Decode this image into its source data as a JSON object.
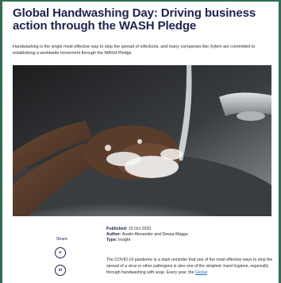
{
  "article": {
    "title": "Global Handwashing Day: Driving business action through the WASH Pledge",
    "intro": "Handwashing is the single most effective way to stop the spread of infections, and many companies like Xylem are committed to establishing a worldwide movement through the WASH Pledge",
    "meta": {
      "published_label": "Published:",
      "published_value": "15 Oct 2020",
      "author_label": "Author:",
      "author_value": "Austin Alexander and Deepa Maggo",
      "type_label": "Type:",
      "type_value": "Insight"
    },
    "body_text": "The COVID-19 pandemic is a stark reminder that one of the most effective ways to stop the spread of a virus or other pathogens is also one of the simplest: hand hygiene, especially through handwashing with soap. Every year, the",
    "body_link": "Global"
  },
  "share": {
    "label": "Share",
    "buttons": [
      {
        "icon": "twitter-icon",
        "glyph": "♥"
      },
      {
        "icon": "linkedin-icon",
        "glyph": "in"
      }
    ]
  },
  "colors": {
    "frame": "#2f6e4f",
    "title": "#1a2350",
    "link": "#1b6ec2"
  }
}
